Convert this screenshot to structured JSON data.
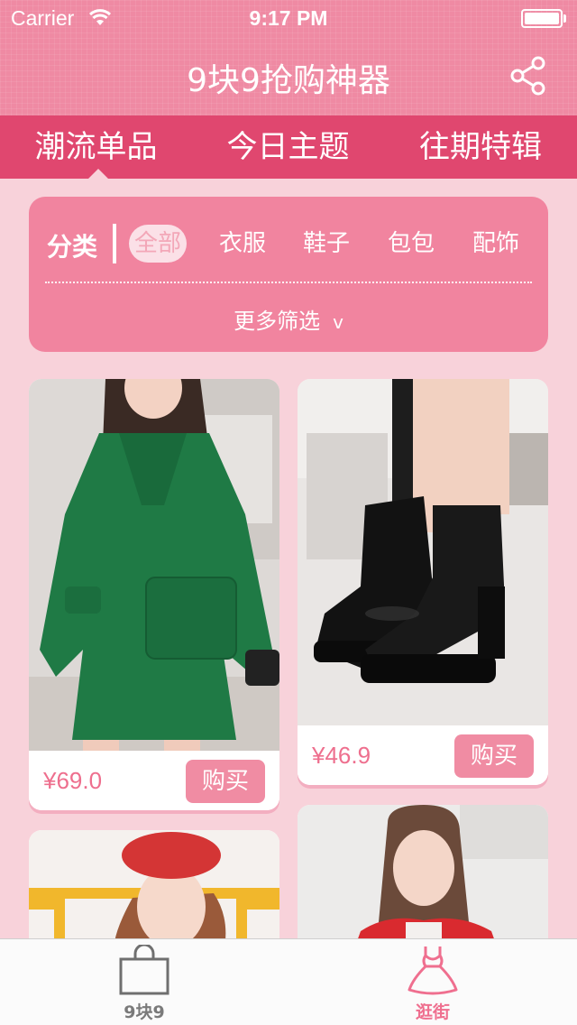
{
  "status_bar": {
    "carrier": "Carrier",
    "time": "9:17 PM"
  },
  "header": {
    "title": "9块9抢购神器",
    "share_icon": "share-icon"
  },
  "tabs": [
    {
      "label": "潮流单品",
      "active": true
    },
    {
      "label": "今日主题",
      "active": false
    },
    {
      "label": "往期特辑",
      "active": false
    }
  ],
  "filter": {
    "label": "分类",
    "chips": [
      {
        "label": "全部",
        "selected": true
      },
      {
        "label": "衣服",
        "selected": false
      },
      {
        "label": "鞋子",
        "selected": false
      },
      {
        "label": "包包",
        "selected": false
      },
      {
        "label": "配饰",
        "selected": false
      }
    ],
    "more_label": "更多筛选",
    "more_chevron": "v"
  },
  "products": [
    {
      "image": "green-coat-photo",
      "price": "¥69.0",
      "buy_label": "购买"
    },
    {
      "image": "black-ankle-boots-photo",
      "price": "¥46.9",
      "buy_label": "购买"
    },
    {
      "image": "girl-red-beret-photo"
    },
    {
      "image": "girl-red-jacket-photo"
    }
  ],
  "bottom_tabs": [
    {
      "label": "9块9",
      "icon": "shopping-bag-icon",
      "active": false
    },
    {
      "label": "逛街",
      "icon": "dress-icon",
      "active": true
    }
  ],
  "colors": {
    "header_pink": "#ef8aa3",
    "tab_bar": "#e0476f",
    "background": "#f8d2da",
    "accent": "#ef6f8f"
  }
}
